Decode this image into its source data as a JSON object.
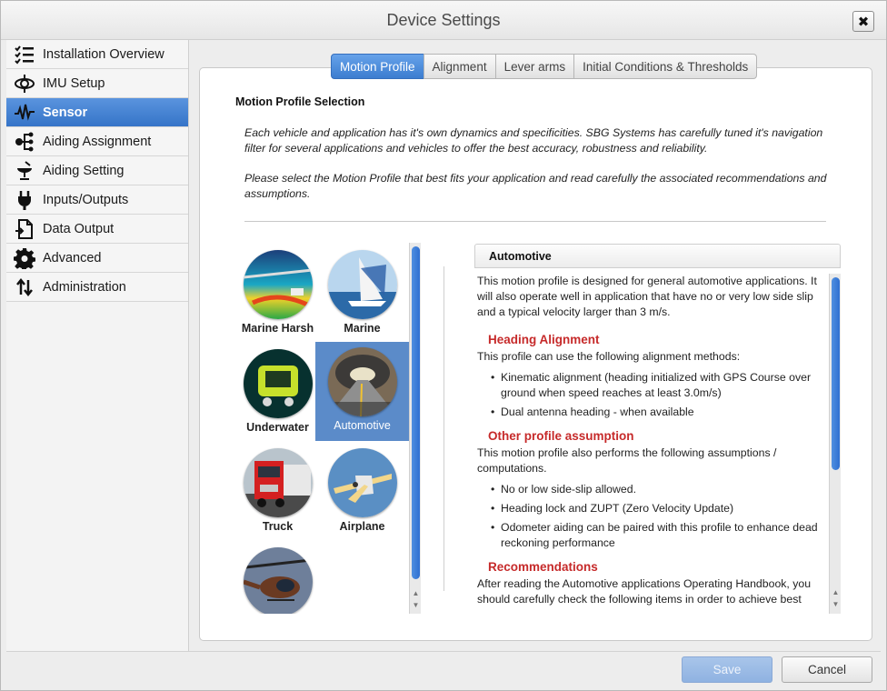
{
  "window": {
    "title": "Device Settings",
    "close_icon": "close-icon"
  },
  "sidebar": {
    "items": [
      {
        "label": "Installation Overview",
        "icon": "checklist-icon",
        "active": false
      },
      {
        "label": "IMU Setup",
        "icon": "imu-icon",
        "active": false
      },
      {
        "label": "Sensor",
        "icon": "waveform-icon",
        "active": true
      },
      {
        "label": "Aiding Assignment",
        "icon": "network-icon",
        "active": false
      },
      {
        "label": "Aiding Setting",
        "icon": "satellite-dish-icon",
        "active": false
      },
      {
        "label": "Inputs/Outputs",
        "icon": "plug-icon",
        "active": false
      },
      {
        "label": "Data Output",
        "icon": "document-icon",
        "active": false
      },
      {
        "label": "Advanced",
        "icon": "gear-icon",
        "active": false
      },
      {
        "label": "Administration",
        "icon": "updown-arrows-icon",
        "active": false
      }
    ]
  },
  "tabs": [
    {
      "label": "Motion Profile",
      "active": true
    },
    {
      "label": "Alignment",
      "active": false
    },
    {
      "label": "Lever arms",
      "active": false
    },
    {
      "label": "Initial Conditions & Thresholds",
      "active": false
    }
  ],
  "main": {
    "section_title": "Motion Profile Selection",
    "intro_p1": "Each vehicle and application has it's own dynamics and specificities. SBG Systems has carefully tuned it's navigation filter for several applications and vehicles to offer the best accuracy, robustness and reliability.",
    "intro_p2": "Please select the Motion Profile that best fits your application and read carefully the associated recommendations and assumptions."
  },
  "profiles": [
    {
      "label": "Marine Harsh",
      "selected": false
    },
    {
      "label": "Marine",
      "selected": false
    },
    {
      "label": "Underwater",
      "selected": false
    },
    {
      "label": "Automotive",
      "selected": true
    },
    {
      "label": "Truck",
      "selected": false
    },
    {
      "label": "Airplane",
      "selected": false
    },
    {
      "label": "",
      "selected": false
    }
  ],
  "detail": {
    "title": "Automotive",
    "intro": "This motion profile is designed for general automotive applications. It will also operate well in application that have no or very low side slip and a typical velocity larger than 3 m/s.",
    "h1": "Heading Alignment",
    "p1": "This profile can use the following alignment methods:",
    "b1": [
      "Kinematic alignment (heading initialized with GPS Course over ground when speed reaches at least 3.0m/s)",
      "Dual antenna heading - when available"
    ],
    "h2": "Other profile assumption",
    "p2": "This motion profile also performs the following assumptions / computations.",
    "b2": [
      "No or low side-slip allowed.",
      "Heading lock and ZUPT (Zero Velocity Update)",
      "Odometer aiding can be paired with this profile to enhance dead reckoning performance"
    ],
    "h3": "Recommendations",
    "p3": "After reading the Automotive applications Operating Handbook, you should carefully check the following items in order to achieve best"
  },
  "footer": {
    "save_label": "Save",
    "cancel_label": "Cancel"
  },
  "colors": {
    "accent": "#3c7dd0",
    "heading_red": "#c62a2a",
    "selected_tile": "#5b8bc9"
  }
}
